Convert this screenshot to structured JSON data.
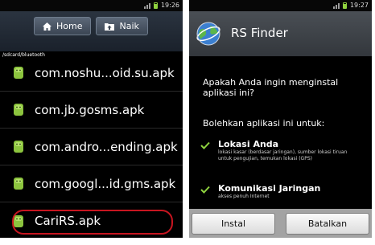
{
  "left_screen": {
    "status": {
      "time": "19:26"
    },
    "nav": {
      "home_label": "Home",
      "up_label": "Naik"
    },
    "path": "/sdcard/bluetooth",
    "files": [
      {
        "name": "com.noshu...oid.su.apk",
        "icon": "android-apk-icon"
      },
      {
        "name": "com.jb.gosms.apk",
        "icon": "android-apk-icon"
      },
      {
        "name": "com.andro...ending.apk",
        "icon": "android-apk-icon"
      },
      {
        "name": "com.googl...id.gms.apk",
        "icon": "android-apk-icon"
      },
      {
        "name": "CariRS.apk",
        "icon": "android-apk-icon",
        "highlighted": true
      }
    ],
    "highlight_color": "#c71520"
  },
  "right_screen": {
    "status": {
      "time": "19:27"
    },
    "app_title": "RS Finder",
    "question": "Apakah Anda ingin menginstal aplikasi ini?",
    "permissions_heading": "Bolehkan aplikasi ini untuk:",
    "permissions": [
      {
        "title": "Lokasi Anda",
        "description": "lokasi kasar (berdasar jaringan), sumber lokasi tiruan untuk pengujian, temukan lokasi (GPS)"
      },
      {
        "title": "Komunikasi Jaringan",
        "description": "akses penuh Internet"
      }
    ],
    "buttons": {
      "install": "Instal",
      "cancel": "Batalkan"
    },
    "accent_color": "#8fd33f"
  }
}
